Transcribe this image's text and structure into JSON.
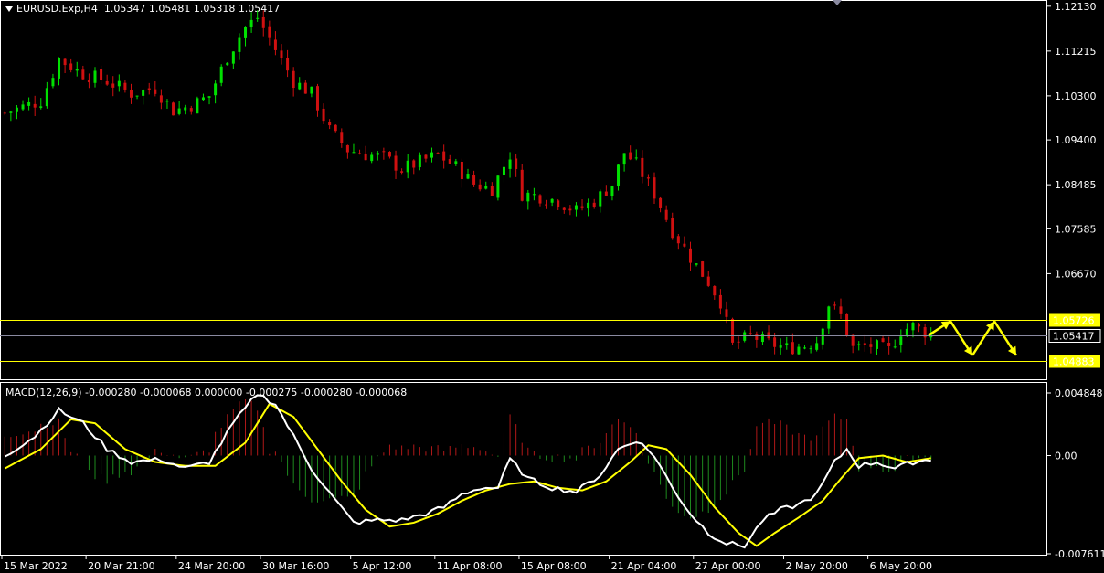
{
  "header": {
    "symbol": "EURUSD.Exp,H4",
    "ohlc": "1.05347 1.05481 1.05318 1.05417"
  },
  "macd_header": "MACD(12,26,9) -0.000280 -0.000068 0.000000 -0.000275 -0.000280 -0.000068",
  "colors": {
    "bull": "#00e000",
    "bear": "#d01010",
    "grid_frame": "#ffffff",
    "level_line": "#ffff00",
    "current_line": "#8a8aa0",
    "macd_line": "#ffffff",
    "signal_line": "#ffff00",
    "hist_pos": "#b01818",
    "hist_neg": "#1e8a1e",
    "arrow": "#ffff00"
  },
  "chart_data": {
    "type": "candlestick",
    "price_axis": {
      "ylim": [
        1.0455,
        1.1222
      ],
      "ticks": [
        "1.12130",
        "1.11215",
        "1.10300",
        "1.09400",
        "1.08485",
        "1.07585",
        "1.06670"
      ]
    },
    "levels": [
      {
        "value": 1.05726,
        "label": "1.05726",
        "style": "yellow-box"
      },
      {
        "value": 1.05417,
        "label": "1.05417",
        "style": "current"
      },
      {
        "value": 1.04883,
        "label": "1.04883",
        "style": "yellow-box"
      }
    ],
    "x_labels": [
      "15 Mar 2022",
      "20 Mar 21:00",
      "24 Mar 20:00",
      "30 Mar 16:00",
      "5 Apr 12:00",
      "11 Apr 08:00",
      "15 Apr 08:00",
      "21 Apr 04:00",
      "27 Apr 00:00",
      "2 May 20:00",
      "6 May 20:00"
    ],
    "close_path": [
      [
        0,
        1.0995
      ],
      [
        6,
        1.102
      ],
      [
        9,
        1.1105
      ],
      [
        13,
        1.1075
      ],
      [
        17,
        1.106
      ],
      [
        21,
        1.1035
      ],
      [
        25,
        1.1045
      ],
      [
        28,
        1.1
      ],
      [
        31,
        1.101
      ],
      [
        34,
        1.103
      ],
      [
        37,
        1.111
      ],
      [
        40,
        1.117
      ],
      [
        42,
        1.119
      ],
      [
        45,
        1.1125
      ],
      [
        48,
        1.106
      ],
      [
        51,
        1.1035
      ],
      [
        54,
        1.096
      ],
      [
        57,
        1.092
      ],
      [
        60,
        1.091
      ],
      [
        63,
        1.0905
      ],
      [
        66,
        1.088
      ],
      [
        69,
        1.0895
      ],
      [
        72,
        1.091
      ],
      [
        75,
        1.0885
      ],
      [
        78,
        1.085
      ],
      [
        81,
        1.084
      ],
      [
        84,
        1.091
      ],
      [
        86,
        1.083
      ],
      [
        89,
        1.0825
      ],
      [
        92,
        1.0815
      ],
      [
        95,
        1.0795
      ],
      [
        98,
        1.0815
      ],
      [
        101,
        1.085
      ],
      [
        103,
        1.0915
      ],
      [
        105,
        1.089
      ],
      [
        108,
        1.083
      ],
      [
        111,
        1.0755
      ],
      [
        114,
        1.07
      ],
      [
        117,
        1.065
      ],
      [
        119,
        1.061
      ],
      [
        121,
        1.052
      ],
      [
        124,
        1.054
      ],
      [
        127,
        1.0525
      ],
      [
        130,
        1.0515
      ],
      [
        133,
        1.052
      ],
      [
        135,
        1.053
      ],
      [
        137,
        1.0605
      ],
      [
        139,
        1.058
      ],
      [
        141,
        1.0515
      ],
      [
        144,
        1.052
      ],
      [
        147,
        1.051
      ],
      [
        149,
        1.055
      ],
      [
        151,
        1.056
      ],
      [
        154,
        1.0542
      ]
    ],
    "candle_count": 155,
    "macd_axis": {
      "ylim": [
        -0.007611,
        0.004848
      ],
      "ticks": [
        "0.004848",
        "0.00",
        "-0.007611"
      ]
    },
    "macd_path": [
      [
        0,
        0.0
      ],
      [
        5,
        0.0015
      ],
      [
        9,
        0.0035
      ],
      [
        13,
        0.0025
      ],
      [
        17,
        0.0005
      ],
      [
        21,
        -0.0005
      ],
      [
        26,
        -0.0003
      ],
      [
        30,
        -0.001
      ],
      [
        34,
        -0.0005
      ],
      [
        38,
        0.0025
      ],
      [
        42,
        0.0048
      ],
      [
        45,
        0.004
      ],
      [
        48,
        0.0015
      ],
      [
        51,
        -0.001
      ],
      [
        55,
        -0.0035
      ],
      [
        58,
        -0.0052
      ],
      [
        62,
        -0.005
      ],
      [
        66,
        -0.005
      ],
      [
        70,
        -0.0045
      ],
      [
        73,
        -0.004
      ],
      [
        76,
        -0.003
      ],
      [
        79,
        -0.0025
      ],
      [
        82,
        -0.0025
      ],
      [
        84,
        -0.0003
      ],
      [
        87,
        -0.0018
      ],
      [
        91,
        -0.0025
      ],
      [
        95,
        -0.0028
      ],
      [
        99,
        -0.0015
      ],
      [
        102,
        0.0005
      ],
      [
        105,
        0.0012
      ],
      [
        108,
        0.0
      ],
      [
        111,
        -0.0025
      ],
      [
        114,
        -0.0045
      ],
      [
        117,
        -0.006
      ],
      [
        120,
        -0.0068
      ],
      [
        123,
        -0.007
      ],
      [
        126,
        -0.005
      ],
      [
        129,
        -0.0042
      ],
      [
        132,
        -0.0038
      ],
      [
        135,
        -0.003
      ],
      [
        138,
        -0.0005
      ],
      [
        140,
        0.0005
      ],
      [
        142,
        -0.0008
      ],
      [
        145,
        -0.0005
      ],
      [
        148,
        -0.001
      ],
      [
        151,
        -0.0005
      ],
      [
        154,
        -0.0003
      ]
    ],
    "signal_path": [
      [
        0,
        -0.001
      ],
      [
        6,
        0.0005
      ],
      [
        11,
        0.0028
      ],
      [
        15,
        0.0025
      ],
      [
        20,
        0.0005
      ],
      [
        25,
        -0.0005
      ],
      [
        30,
        -0.0008
      ],
      [
        35,
        -0.0008
      ],
      [
        40,
        0.001
      ],
      [
        44,
        0.004
      ],
      [
        48,
        0.003
      ],
      [
        52,
        0.0005
      ],
      [
        56,
        -0.002
      ],
      [
        60,
        -0.0042
      ],
      [
        64,
        -0.0055
      ],
      [
        68,
        -0.0052
      ],
      [
        72,
        -0.0045
      ],
      [
        76,
        -0.0035
      ],
      [
        80,
        -0.0027
      ],
      [
        84,
        -0.0022
      ],
      [
        88,
        -0.002
      ],
      [
        92,
        -0.0025
      ],
      [
        96,
        -0.0027
      ],
      [
        100,
        -0.002
      ],
      [
        104,
        -0.0005
      ],
      [
        107,
        0.0008
      ],
      [
        110,
        0.0005
      ],
      [
        114,
        -0.0015
      ],
      [
        118,
        -0.004
      ],
      [
        122,
        -0.006
      ],
      [
        125,
        -0.007
      ],
      [
        128,
        -0.006
      ],
      [
        132,
        -0.0048
      ],
      [
        136,
        -0.0035
      ],
      [
        139,
        -0.0018
      ],
      [
        142,
        -0.0002
      ],
      [
        146,
        0.0
      ],
      [
        150,
        -0.0005
      ],
      [
        154,
        -0.0002
      ]
    ],
    "projection_arrows": [
      [
        1.0541,
        1.057
      ],
      [
        1.057,
        1.05
      ],
      [
        1.05,
        1.057
      ],
      [
        1.057,
        1.05
      ]
    ]
  }
}
